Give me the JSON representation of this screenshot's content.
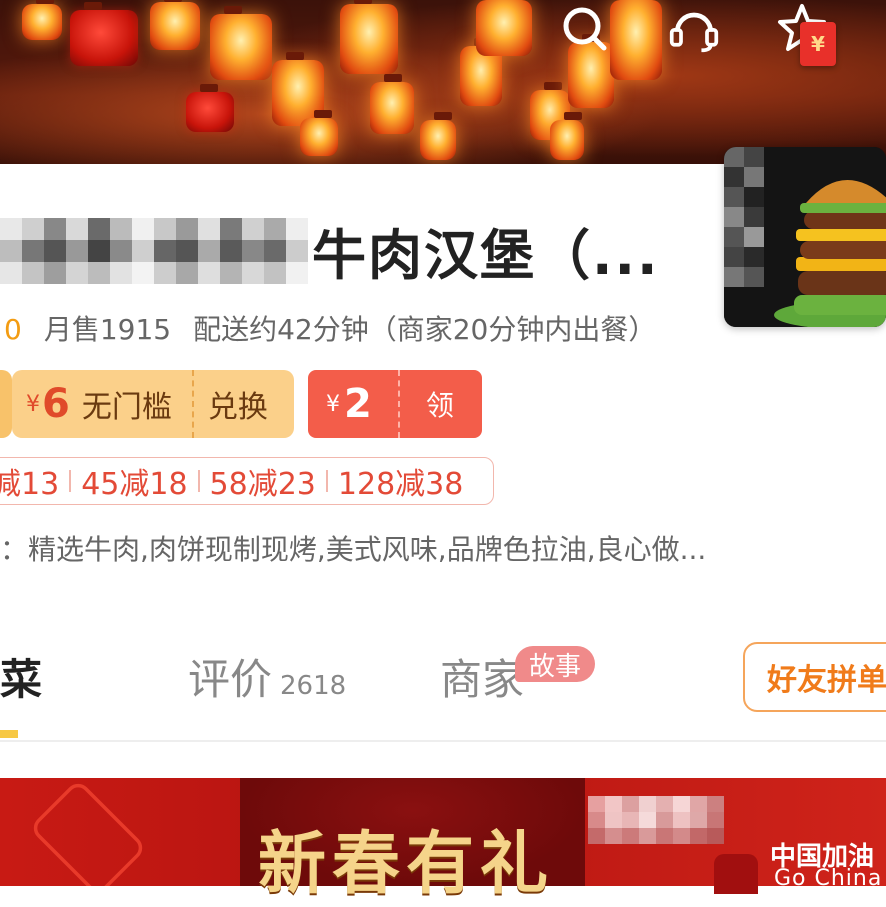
{
  "store": {
    "name_tail": "牛肉汉堡（...",
    "rating": "0",
    "monthly_sales": "月售1915",
    "delivery": "配送约42分钟（商家20分钟内出餐）"
  },
  "coupons": {
    "exchange": {
      "currency": "¥",
      "amount": "6",
      "desc": "无门槛",
      "action": "兑换"
    },
    "claim": {
      "currency": "¥",
      "amount": "2",
      "action": "领"
    }
  },
  "discounts": [
    "减13",
    "45减18",
    "58减23",
    "128减38"
  ],
  "notice": "：精选牛肉,肉饼现制现烤,美式风味,品牌色拉油,良心做...",
  "tabs": {
    "dishes": "菜",
    "reviews": "评价",
    "reviews_count": "2618",
    "merchant": "商家",
    "story_badge": "故事"
  },
  "group_button": "好友拼单",
  "promo": {
    "title": "新春有礼",
    "right_line1": "中国加油",
    "right_line2": "Go China"
  },
  "redpack_symbol": "¥",
  "icons": [
    "search-icon",
    "customer-service-icon",
    "favorite-star-icon",
    "red-packet-icon"
  ],
  "colors": {
    "accent_orange": "#f07b1a",
    "coupon_yellow": "#fbd08a",
    "coupon_red": "#f35d4a",
    "discount_red": "#e34a37",
    "tab_underline": "#f7c844"
  }
}
